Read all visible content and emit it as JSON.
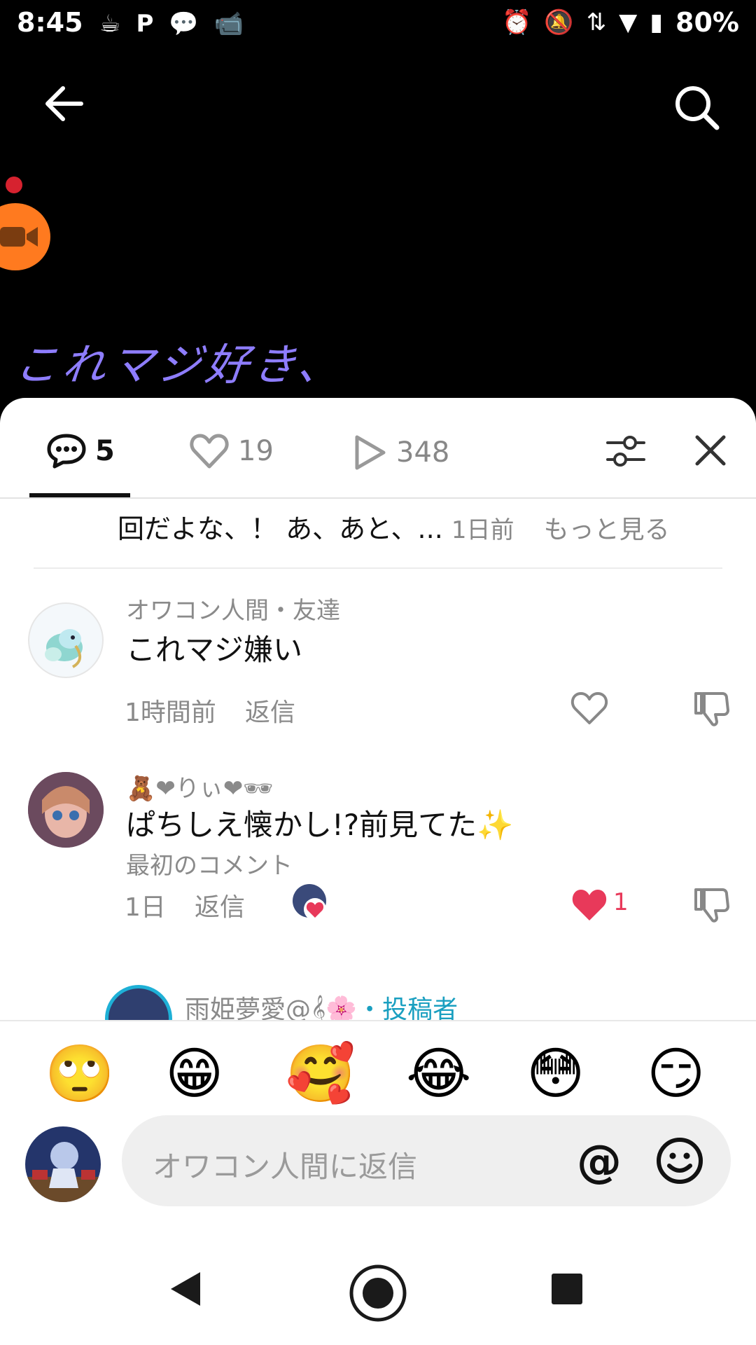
{
  "status_bar": {
    "time": "8:45",
    "battery": "80%"
  },
  "video": {
    "caption": "これマジ好き、"
  },
  "tabs": {
    "comments_count": "5",
    "likes_count": "19",
    "views_count": "348"
  },
  "previous_comment": {
    "text": "回だよな、！ あ、あと、...",
    "time": "1日前",
    "more_label": "もっと見る"
  },
  "comments": [
    {
      "author": "オワコン人間・友達",
      "text": "これマジ嫌い",
      "time": "1時間前",
      "reply_label": "返信"
    },
    {
      "author": "🧸❤りぃ❤🕶",
      "text": "ぱちしえ懐かし!?前見てた✨",
      "note": "最初のコメント",
      "time": "1日",
      "reply_label": "返信",
      "like_count": "1"
    },
    {
      "author": "雨姫夢愛@𝄞🌸",
      "creator_tag": "・投稿者"
    }
  ],
  "emojis": [
    "🙄",
    "😁",
    "🥰",
    "😂",
    "😳",
    "😏"
  ],
  "reply": {
    "placeholder": "オワコン人間に返信",
    "at_symbol": "@"
  },
  "colors": {
    "accent_like": "#e8395a",
    "creator": "#1a9fc0",
    "caption": "#8e7dff"
  }
}
